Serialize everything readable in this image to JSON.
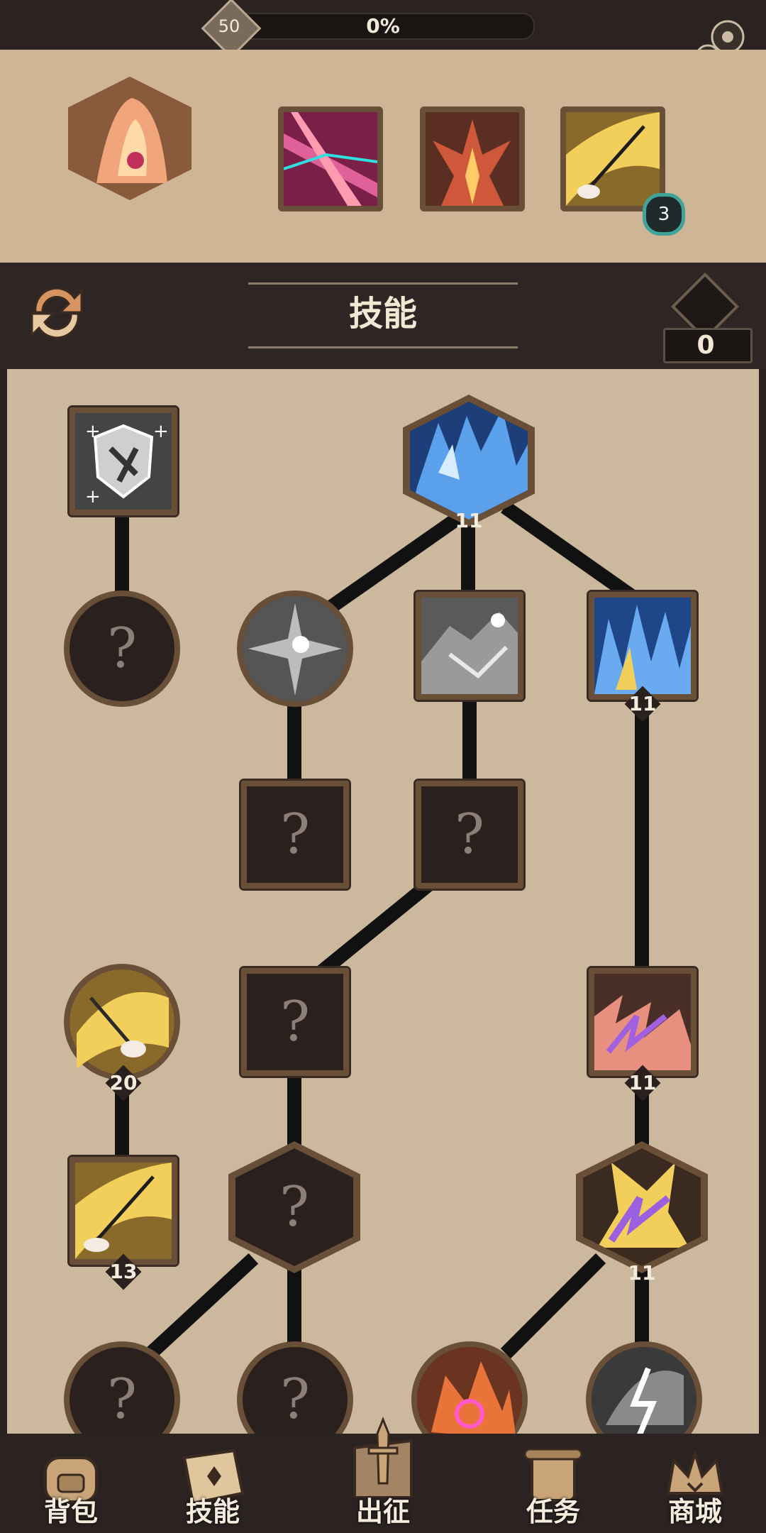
{
  "colors": {
    "panel": "#ccb89c",
    "frame": "#6a4f38",
    "dark": "#2b2321",
    "badge_ring": "#3fa39a"
  },
  "top": {
    "level": "50",
    "xp_percent": "0%",
    "settings_icon": "gear-icon"
  },
  "heroes": [
    {
      "name": "hero-1",
      "icon": "fire-mask-icon"
    },
    {
      "name": "hero-2",
      "icon": "magenta-slash-icon"
    },
    {
      "name": "hero-3",
      "icon": "flame-burst-icon"
    },
    {
      "name": "hero-4",
      "icon": "golden-blade-icon",
      "badge": "3"
    }
  ],
  "header": {
    "title": "技能",
    "points": "0",
    "swap_icon": "swap-icon",
    "points_icon": "diamond-icon"
  },
  "tree": {
    "locked_mark": "?",
    "nodes": [
      {
        "id": "shield-rune",
        "icon": "shield-rune-icon",
        "level": ""
      },
      {
        "id": "ice-crystal",
        "icon": "ice-crystal-icon",
        "level": "11"
      },
      {
        "id": "light-orb",
        "icon": "light-orb-icon",
        "level": ""
      },
      {
        "id": "stone-claw",
        "icon": "stone-claw-icon",
        "level": ""
      },
      {
        "id": "blue-shards",
        "icon": "blue-shards-icon",
        "level": "11"
      },
      {
        "id": "golden-grasp",
        "icon": "golden-grasp-icon",
        "level": "20"
      },
      {
        "id": "violet-bolt",
        "icon": "violet-bolt-icon",
        "level": "11"
      },
      {
        "id": "golden-blade",
        "icon": "golden-blade-icon",
        "level": "13"
      },
      {
        "id": "purple-spark",
        "icon": "purple-spark-icon",
        "level": "11"
      },
      {
        "id": "flame-ring",
        "icon": "flame-ring-icon",
        "level": ""
      },
      {
        "id": "silver-lightning",
        "icon": "silver-lightning-icon",
        "level": ""
      }
    ]
  },
  "nav": [
    {
      "label": "背包",
      "icon": "backpack-icon"
    },
    {
      "label": "技能",
      "icon": "skill-book-icon"
    },
    {
      "label": "出征",
      "icon": "sword-icon"
    },
    {
      "label": "任务",
      "icon": "scroll-icon"
    },
    {
      "label": "商城",
      "icon": "crown-shop-icon"
    }
  ]
}
